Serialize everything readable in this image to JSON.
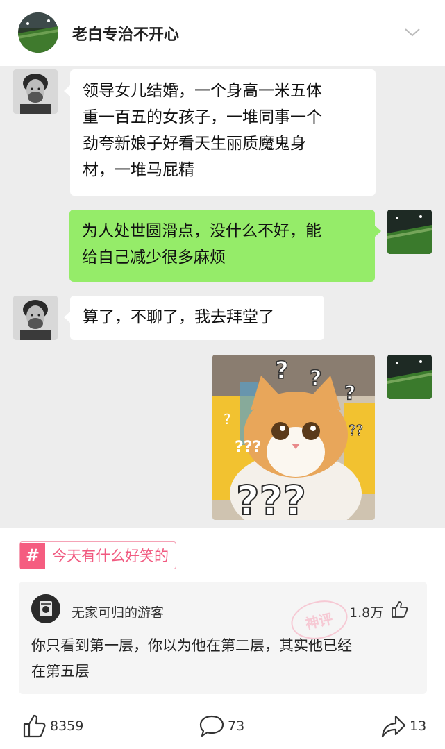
{
  "header": {
    "title": "老白专治不开心"
  },
  "messages": [
    {
      "side": "left",
      "lines": [
        "领导女儿结婚，一个身高一米五体",
        "重一百五的女孩子，一堆同事一个",
        "劲夸新娘子好看天生丽质魔鬼身",
        "材，一堆马屁精"
      ]
    },
    {
      "side": "right",
      "lines": [
        "为人处世圆滑点，没什么不好，能",
        "给自己减少很多麻烦"
      ]
    },
    {
      "side": "left",
      "lines": [
        "算了，不聊了，我去拜堂了"
      ]
    },
    {
      "side": "right",
      "image": "cat-question-marks",
      "overlay_text": "???"
    }
  ],
  "topic": {
    "symbol": "#",
    "label": "今天有什么好笑的"
  },
  "comment": {
    "author": "无家可归的游客",
    "likes": "1.8万",
    "text_lines": [
      "你只看到第一层，你以为他在第二层，其实他已经",
      "在第五层"
    ],
    "stamp": "神评"
  },
  "actions": {
    "likes": "8359",
    "comments": "73",
    "shares": "13"
  },
  "colors": {
    "chat_bg": "#ededed",
    "bubble_right": "#95ec69",
    "bubble_left": "#ffffff",
    "topic_accent": "#f55d80"
  }
}
